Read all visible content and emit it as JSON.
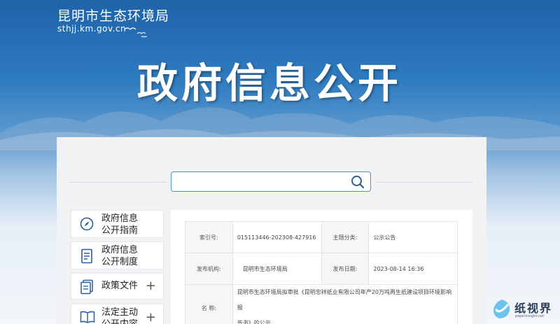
{
  "header": {
    "site_name": "昆明市生态环境局",
    "site_url": "sthjj.km.gov.cn",
    "hero_title": "政府信息公开"
  },
  "search": {
    "placeholder": ""
  },
  "sidebar": {
    "items": [
      {
        "label_line1": "政府信息",
        "label_line2": "公开指南",
        "icon": "compass-icon",
        "expandable": false
      },
      {
        "label_line1": "政府信息",
        "label_line2": "公开制度",
        "icon": "document-icon",
        "expandable": false
      },
      {
        "label_line1": "政策文件",
        "label_line2": "",
        "icon": "files-icon",
        "expandable": true
      },
      {
        "label_line1": "法定主动",
        "label_line2": "公开内容",
        "icon": "book-icon",
        "expandable": true
      }
    ],
    "expand_symbol": "+"
  },
  "detail": {
    "index_label": "索引号:",
    "index_value": "015113446-202308-427916",
    "category_label": "主题分类:",
    "category_value": "公示公告",
    "publisher_label": "发布机构:",
    "publisher_value": "昆明市生态环境局",
    "date_label": "发布日期:",
    "date_value": "2023-08-14 16:36",
    "name_label": "名 称:",
    "name_value_line1": "昆明市生态环境局拟审批《昆明忠祥纸业有限公司年产20万吨再生纸建设项目环境影响报",
    "name_value_line2": "告书》的公示"
  },
  "watermark": {
    "text": "纸视界",
    "url": "paperinsight.net"
  },
  "colors": {
    "brand_blue": "#1f62a8",
    "search_border": "#4f8fd0",
    "icon_blue": "#2a5f9e"
  }
}
